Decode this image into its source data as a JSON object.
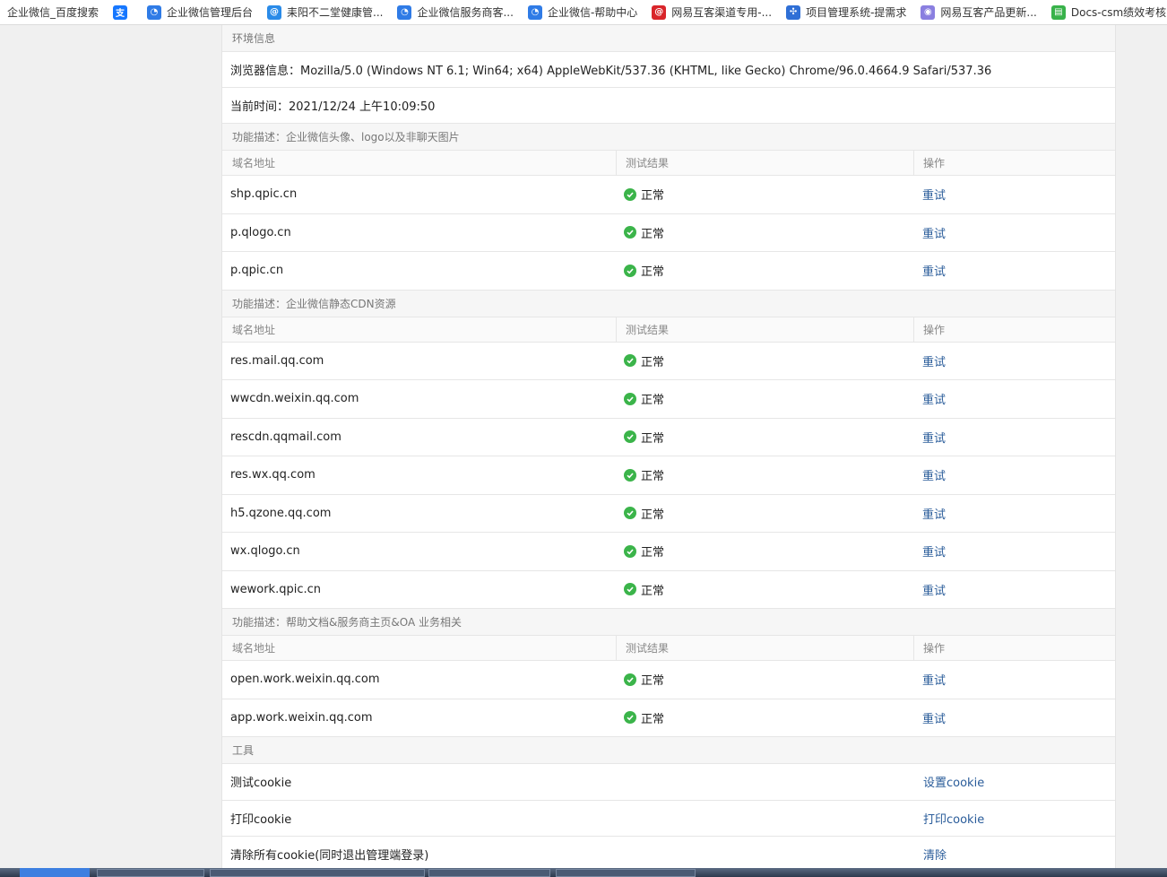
{
  "bookmarks": [
    {
      "label": "企业微信_百度搜索",
      "icon": "none",
      "color": ""
    },
    {
      "label": "",
      "icon": "alipay-icon",
      "color": "#1677ff"
    },
    {
      "label": "企业微信管理后台",
      "icon": "wecom-icon",
      "color": "#2f7be6"
    },
    {
      "label": "耒阳不二堂健康管...",
      "icon": "at-icon",
      "color": "#2a8be8"
    },
    {
      "label": "企业微信服务商客...",
      "icon": "wecom-icon",
      "color": "#2f7be6"
    },
    {
      "label": "企业微信-帮助中心",
      "icon": "wecom-icon",
      "color": "#2f7be6"
    },
    {
      "label": "网易互客渠道专用-...",
      "icon": "netease-icon",
      "color": "#d9252a"
    },
    {
      "label": "项目管理系统-提需求",
      "icon": "project-icon",
      "color": "#2f6fd6"
    },
    {
      "label": "网易互客产品更新...",
      "icon": "netease-product-icon",
      "color": "#8a7fe0"
    },
    {
      "label": "Docs-csm绩效考核",
      "icon": "docs-icon",
      "color": "#38b24a"
    }
  ],
  "env": {
    "section_title": "环境信息",
    "browser_info": "浏览器信息：Mozilla/5.0 (Windows NT 6.1; Win64; x64) AppleWebKit/537.36 (KHTML, like Gecko) Chrome/96.0.4664.9 Safari/537.36",
    "current_time": "当前时间：2021/12/24 上午10:09:50"
  },
  "columns": {
    "domain": "域名地址",
    "result": "测试结果",
    "action": "操作"
  },
  "groups": [
    {
      "title": "功能描述：企业微信头像、logo以及非聊天图片",
      "rows": [
        {
          "domain": "shp.qpic.cn",
          "status": "正常",
          "action": "重试"
        },
        {
          "domain": "p.qlogo.cn",
          "status": "正常",
          "action": "重试"
        },
        {
          "domain": "p.qpic.cn",
          "status": "正常",
          "action": "重试"
        }
      ]
    },
    {
      "title": "功能描述：企业微信静态CDN资源",
      "rows": [
        {
          "domain": "res.mail.qq.com",
          "status": "正常",
          "action": "重试"
        },
        {
          "domain": "wwcdn.weixin.qq.com",
          "status": "正常",
          "action": "重试"
        },
        {
          "domain": "rescdn.qqmail.com",
          "status": "正常",
          "action": "重试"
        },
        {
          "domain": "res.wx.qq.com",
          "status": "正常",
          "action": "重试"
        },
        {
          "domain": "h5.qzone.qq.com",
          "status": "正常",
          "action": "重试"
        },
        {
          "domain": "wx.qlogo.cn",
          "status": "正常",
          "action": "重试"
        },
        {
          "domain": "wework.qpic.cn",
          "status": "正常",
          "action": "重试"
        }
      ]
    },
    {
      "title": "功能描述：帮助文档&服务商主页&OA 业务相关",
      "rows": [
        {
          "domain": "open.work.weixin.qq.com",
          "status": "正常",
          "action": "重试"
        },
        {
          "domain": "app.work.weixin.qq.com",
          "status": "正常",
          "action": "重试"
        }
      ]
    }
  ],
  "tools": {
    "section_title": "工具",
    "rows": [
      {
        "label": "测试cookie",
        "action": "设置cookie"
      },
      {
        "label": "打印cookie",
        "action": "打印cookie"
      },
      {
        "label": "清除所有cookie(同时退出管理端登录)",
        "action": "清除"
      }
    ]
  },
  "colors": {
    "status_ok": "#3bb44a",
    "link": "#2a5c9a"
  }
}
